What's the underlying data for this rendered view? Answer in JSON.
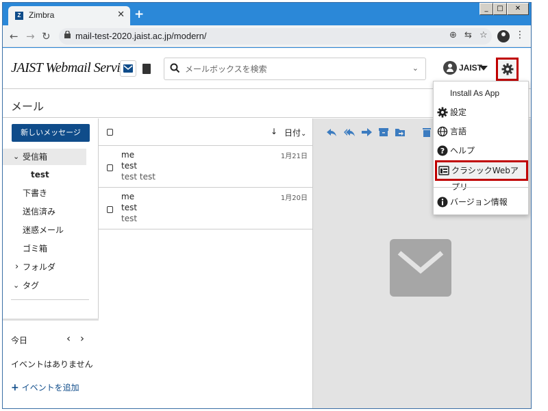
{
  "browser": {
    "tab_title": "Zimbra",
    "tab_favicon": "Z",
    "tab_close": "✕",
    "new_tab": "+",
    "window_controls": [
      "_",
      "□",
      "✕"
    ],
    "url": "mail-test-2020.jaist.ac.jp/modern/"
  },
  "app": {
    "brand": "JAIST Webmail Service",
    "search_placeholder": "メールボックスを検索",
    "user_name": "JAIST",
    "page_title": "メール"
  },
  "sidebar": {
    "compose_label": "新しいメッセージ",
    "folders": [
      {
        "label": "受信箱",
        "prefix": "⌄"
      },
      {
        "label": "test",
        "prefix": ""
      },
      {
        "label": "下書き",
        "prefix": ""
      },
      {
        "label": "送信済み",
        "prefix": ""
      },
      {
        "label": "迷惑メール",
        "prefix": ""
      },
      {
        "label": "ゴミ箱",
        "prefix": ""
      },
      {
        "label": "フォルダ",
        "prefix": "›"
      },
      {
        "label": "タグ",
        "prefix": "⌄"
      }
    ],
    "calendar": {
      "today": "今日",
      "prev": "‹",
      "next": "›",
      "no_events": "イベントはありません",
      "add_event": "イベントを追加",
      "add_prefix": "+"
    }
  },
  "message_list": {
    "sort_label": "日付",
    "sort_arrow": "↓",
    "sort_caret": "⌄",
    "messages": [
      {
        "from": "me",
        "subject": "test",
        "preview": "test test",
        "date": "1月21日"
      },
      {
        "from": "me",
        "subject": "test",
        "preview": "test",
        "date": "1月20日"
      }
    ]
  },
  "menu": {
    "items": [
      {
        "label": "Install As App",
        "icon": "none"
      },
      {
        "label": "設定",
        "icon": "gear-icon"
      },
      {
        "label": "言語",
        "icon": "globe-icon"
      },
      {
        "label": "ヘルプ",
        "icon": "help-icon"
      },
      {
        "label": "クラシックWebアプリ",
        "icon": "classic-app-icon"
      },
      {
        "label": "バージョン情報",
        "icon": "info-icon"
      }
    ]
  },
  "colors": {
    "brand_blue": "#0f4c8a",
    "action_blue": "#3c7cc0",
    "highlight_red": "#c00000",
    "chrome_blue": "#2b88d8"
  }
}
